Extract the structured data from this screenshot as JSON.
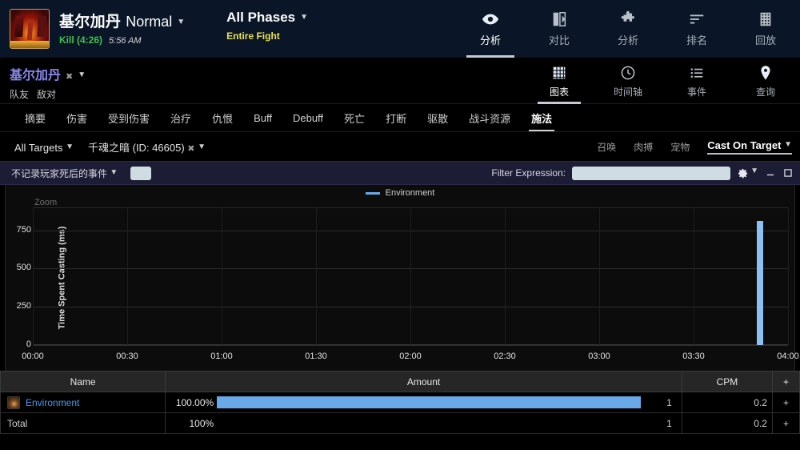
{
  "header": {
    "boss_name": "基尔加丹",
    "difficulty": "Normal",
    "kill_text": "Kill (4:26)",
    "time_text": "5:56 AM",
    "phase_title": "All Phases",
    "phase_sub": "Entire Fight",
    "nav": [
      {
        "label": "分析",
        "icon": "eye-icon",
        "active": true
      },
      {
        "label": "对比",
        "icon": "compare-icon",
        "active": false
      },
      {
        "label": "分析",
        "icon": "puzzle-icon",
        "active": false
      },
      {
        "label": "排名",
        "icon": "ranking-icon",
        "active": false
      },
      {
        "label": "回放",
        "icon": "replay-icon",
        "active": false
      }
    ]
  },
  "subheader": {
    "player_name": "基尔加丹",
    "factions": [
      "队友",
      "敌对"
    ],
    "nav": [
      {
        "label": "图表",
        "icon": "grid-icon",
        "active": true
      },
      {
        "label": "时间轴",
        "icon": "clock-icon",
        "active": false
      },
      {
        "label": "事件",
        "icon": "list-icon",
        "active": false
      },
      {
        "label": "查询",
        "icon": "pin-icon",
        "active": false
      }
    ]
  },
  "tabs": [
    {
      "label": "摘要",
      "active": false
    },
    {
      "label": "伤害",
      "active": false
    },
    {
      "label": "受到伤害",
      "active": false
    },
    {
      "label": "治疗",
      "active": false
    },
    {
      "label": "仇恨",
      "active": false
    },
    {
      "label": "Buff",
      "active": false
    },
    {
      "label": "Debuff",
      "active": false
    },
    {
      "label": "死亡",
      "active": false
    },
    {
      "label": "打断",
      "active": false
    },
    {
      "label": "驱散",
      "active": false
    },
    {
      "label": "战斗资源",
      "active": false
    },
    {
      "label": "施法",
      "active": true
    }
  ],
  "filterbar": {
    "targets_label": "All Targets",
    "ability_label": "千魂之暗 (ID: 46605)",
    "options": [
      "召唤",
      "肉搏",
      "宠物"
    ],
    "view_selector": "Cast On Target"
  },
  "optionsbar": {
    "death_filter": "不记录玩家死后的事件",
    "filter_expression_label": "Filter Expression:",
    "filter_expression_value": "",
    "filter_expression_placeholder": "",
    "gear_icon": "gear-icon",
    "minimize_icon": "minimize-icon",
    "maximize_icon": "maximize-icon"
  },
  "chart_data": {
    "type": "bar",
    "title": "",
    "legend": [
      "Environment"
    ],
    "legend_position": "top-center",
    "zoom_label": "Zoom",
    "xlabel": "",
    "ylabel": "Time Spent Casting (ms)",
    "yticks": [
      0,
      250,
      500,
      750
    ],
    "ylim": [
      0,
      900
    ],
    "xticks": [
      "00:00",
      "00:30",
      "01:00",
      "01:30",
      "02:00",
      "02:30",
      "03:00",
      "03:30",
      "04:00"
    ],
    "xlim": [
      0,
      266
    ],
    "grid": true,
    "series": [
      {
        "name": "Environment",
        "color": "#8dc0f0",
        "points": [
          {
            "x": 256,
            "y": 810
          }
        ]
      }
    ]
  },
  "table": {
    "columns": [
      "Name",
      "Amount",
      "CPM",
      "+"
    ],
    "rows": [
      {
        "name": "Environment",
        "icon": "environment-icon",
        "percent": "100.00%",
        "bar_pct": 100,
        "amount": "1",
        "cpm": "0.2",
        "plus": "+"
      }
    ],
    "total": {
      "name": "Total",
      "percent": "100%",
      "amount": "1",
      "cpm": "0.2",
      "plus": "+"
    }
  }
}
